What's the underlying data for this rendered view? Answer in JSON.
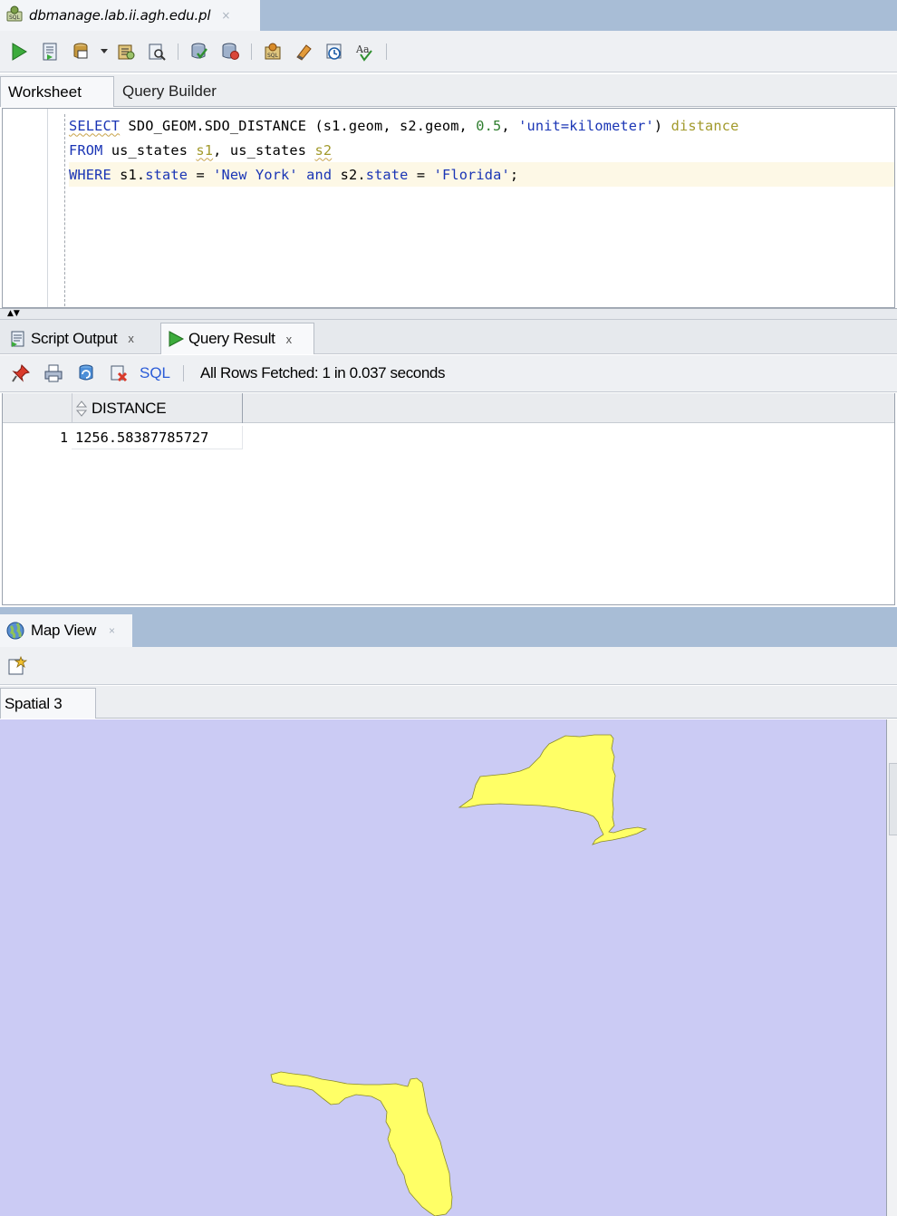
{
  "document_tab": {
    "title": "dbmanage.lab.ii.agh.edu.pl",
    "close": "×"
  },
  "worksheet_tabs": [
    {
      "label": "Worksheet"
    },
    {
      "label": "Query Builder"
    }
  ],
  "editor": {
    "lines": [
      {
        "tokens": [
          {
            "t": "SELECT",
            "c": "kw squig"
          },
          {
            "t": " SDO_GEOM.SDO_DISTANCE (s1.geom, s2.geom, ",
            "c": ""
          },
          {
            "t": "0.5",
            "c": "num"
          },
          {
            "t": ", ",
            "c": ""
          },
          {
            "t": "'unit=kilometer'",
            "c": "str"
          },
          {
            "t": ") ",
            "c": ""
          },
          {
            "t": "distance",
            "c": "alias"
          }
        ]
      },
      {
        "tokens": [
          {
            "t": "FROM",
            "c": "kw"
          },
          {
            "t": " us_states ",
            "c": ""
          },
          {
            "t": "s1",
            "c": "alias squig"
          },
          {
            "t": ", us_states ",
            "c": ""
          },
          {
            "t": "s2",
            "c": "alias squig"
          }
        ]
      },
      {
        "tokens": [
          {
            "t": "WHERE",
            "c": "kw"
          },
          {
            "t": " s1.",
            "c": ""
          },
          {
            "t": "state",
            "c": "kw"
          },
          {
            "t": " = ",
            "c": ""
          },
          {
            "t": "'New York'",
            "c": "str"
          },
          {
            "t": " ",
            "c": ""
          },
          {
            "t": "and",
            "c": "kw"
          },
          {
            "t": " s2.",
            "c": ""
          },
          {
            "t": "state",
            "c": "kw"
          },
          {
            "t": " = ",
            "c": ""
          },
          {
            "t": "'Florida'",
            "c": "str"
          },
          {
            "t": ";",
            "c": ""
          }
        ]
      }
    ]
  },
  "output_tabs": [
    {
      "label": "Script Output",
      "close": "x"
    },
    {
      "label": "Query Result",
      "close": "x"
    }
  ],
  "result_toolbar": {
    "sql_label": "SQL",
    "status": "All Rows Fetched: 1 in 0.037 seconds"
  },
  "result_grid": {
    "columns": [
      "DISTANCE"
    ],
    "rows": [
      {
        "num": "1",
        "values": [
          "1256.58387785727"
        ]
      }
    ]
  },
  "map_view": {
    "tab_label": "Map View",
    "tab_close": "×",
    "spatial_tab": "Spatial 3",
    "background_color": "#cbcbf4",
    "shape_color": "#ffff66",
    "shapes": [
      "New York",
      "Florida"
    ]
  },
  "colors": {
    "keyword": "#1a35b5",
    "string": "#1a35b5",
    "number": "#2e7d2e",
    "alias": "#a29a2c",
    "current_line": "#fdf8e6",
    "tab_bar": "#a8bdd6"
  }
}
